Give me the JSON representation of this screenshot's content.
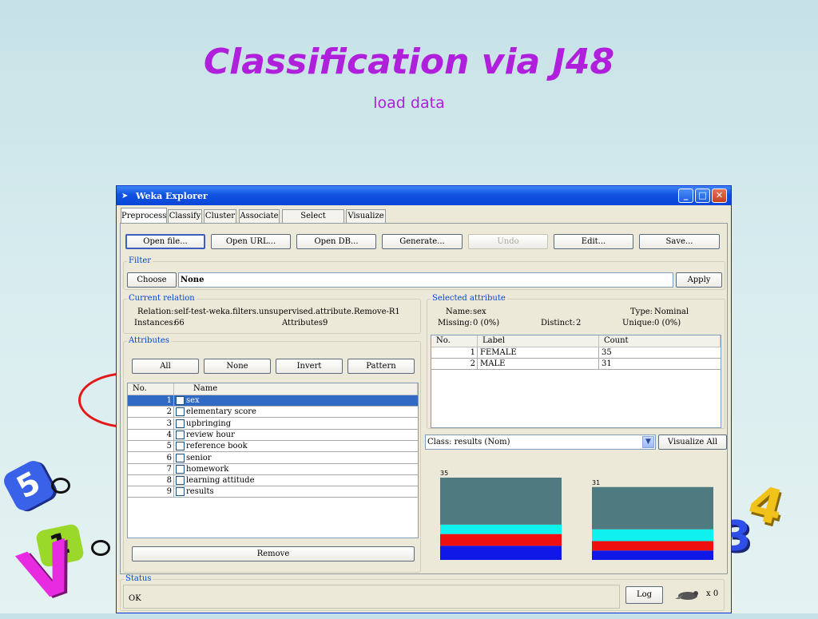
{
  "slide": {
    "title": "Classification via J48",
    "subtitle": "load data"
  },
  "decorations": {
    "digits": [
      "5",
      "1",
      "3",
      "4"
    ]
  },
  "window": {
    "title": "Weka Explorer",
    "tabs": [
      "Preprocess",
      "Classify",
      "Cluster",
      "Associate",
      "Select attributes",
      "Visualize"
    ],
    "toolbar": {
      "open_file": "Open file...",
      "open_url": "Open URL...",
      "open_db": "Open DB...",
      "generate": "Generate...",
      "undo": "Undo",
      "edit": "Edit...",
      "save": "Save..."
    },
    "filter": {
      "label": "Filter",
      "choose": "Choose",
      "value": "None",
      "apply": "Apply"
    },
    "current_relation": {
      "label": "Current relation",
      "relation_label": "Relation:",
      "relation_value": "self-test-weka.filters.unsupervised.attribute.Remove-R1",
      "instances_label": "Instances:",
      "instances_value": "66",
      "attributes_label": "Attributes:",
      "attributes_value": "9"
    },
    "attributes": {
      "label": "Attributes",
      "buttons": {
        "all": "All",
        "none": "None",
        "invert": "Invert",
        "pattern": "Pattern"
      },
      "headers": {
        "no": "No.",
        "name": "Name"
      },
      "rows": [
        {
          "no": "1",
          "name": "sex"
        },
        {
          "no": "2",
          "name": "elementary score"
        },
        {
          "no": "3",
          "name": "upbringing"
        },
        {
          "no": "4",
          "name": "review hour"
        },
        {
          "no": "5",
          "name": "reference book"
        },
        {
          "no": "6",
          "name": "senior"
        },
        {
          "no": "7",
          "name": "homework"
        },
        {
          "no": "8",
          "name": "learning attitude"
        },
        {
          "no": "9",
          "name": "results"
        }
      ],
      "remove": "Remove"
    },
    "selected_attribute": {
      "label": "Selected attribute",
      "name_label": "Name:",
      "name_value": "sex",
      "type_label": "Type:",
      "type_value": "Nominal",
      "missing_label": "Missing:",
      "missing_value": "0 (0%)",
      "distinct_label": "Distinct:",
      "distinct_value": "2",
      "unique_label": "Unique:",
      "unique_value": "0 (0%)",
      "headers": {
        "no": "No.",
        "label": "Label",
        "count": "Count"
      },
      "rows": [
        {
          "no": "1",
          "label": "FEMALE",
          "count": "35"
        },
        {
          "no": "2",
          "label": "MALE",
          "count": "31"
        }
      ]
    },
    "class_select": {
      "value": "Class: results (Nom)",
      "visualize_all": "Visualize All"
    },
    "status": {
      "label": "Status",
      "value": "OK",
      "log": "Log",
      "tasks": "x 0"
    }
  },
  "chart_data": {
    "type": "bar",
    "stacked": true,
    "categories": [
      "FEMALE",
      "MALE"
    ],
    "values": [
      35,
      31
    ],
    "segments": [
      {
        "color": "#1018e8",
        "values": [
          6,
          4
        ]
      },
      {
        "color": "#ee1010",
        "values": [
          5,
          4
        ]
      },
      {
        "color": "#10f0ee",
        "values": [
          4,
          5
        ]
      },
      {
        "color": "#4e7a80",
        "values": [
          20,
          18
        ]
      }
    ],
    "ylim": [
      0,
      35
    ]
  }
}
